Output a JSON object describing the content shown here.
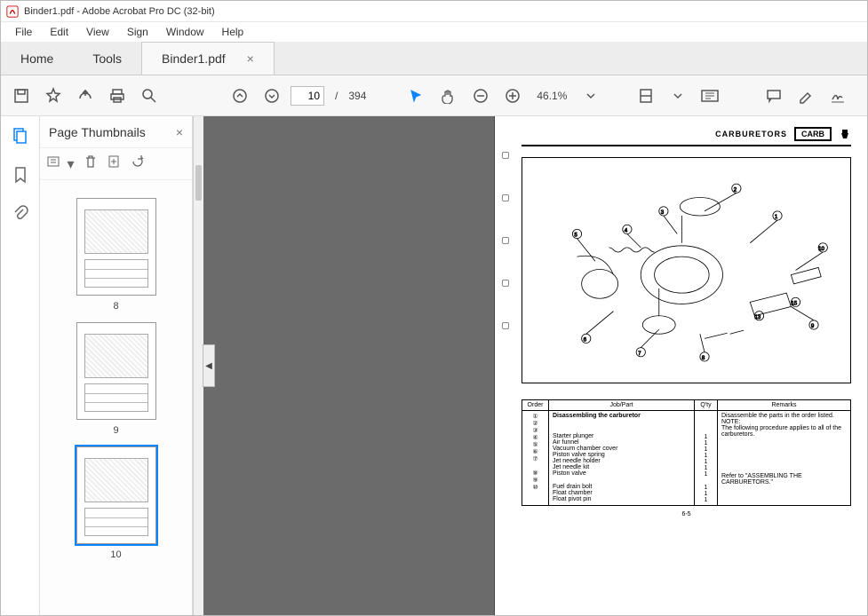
{
  "window": {
    "title": "Binder1.pdf - Adobe Acrobat Pro DC (32-bit)"
  },
  "menu": {
    "file": "File",
    "edit": "Edit",
    "view": "View",
    "sign": "Sign",
    "window": "Window",
    "help": "Help"
  },
  "tabs": {
    "home": "Home",
    "tools": "Tools",
    "doc": "Binder1.pdf"
  },
  "toolbar": {
    "page_current": "10",
    "page_total": "394",
    "zoom": "46.1%",
    "page_sep": "/"
  },
  "thumbs": {
    "title": "Page Thumbnails",
    "items": [
      {
        "num": "8"
      },
      {
        "num": "9"
      },
      {
        "num": "10"
      }
    ]
  },
  "doc": {
    "section": "CARBURETORS",
    "box_label": "CARB",
    "page_num": "6-5",
    "table": {
      "headers": {
        "order": "Order",
        "job": "Job/Part",
        "qty": "Q'ty",
        "remarks": "Remarks"
      },
      "title_row": {
        "job": "Disassembling the carburetor",
        "remarks": "Disassemble the parts in the order listed.\nNOTE:\nThe following procedure applies to all of the carburetors."
      },
      "rows": [
        {
          "order": "①",
          "job": "Starter plunger",
          "qty": "1"
        },
        {
          "order": "②",
          "job": "Air funnel",
          "qty": "1"
        },
        {
          "order": "③",
          "job": "Vacuum chamber cover",
          "qty": "1"
        },
        {
          "order": "④",
          "job": "Piston valve spring",
          "qty": "1"
        },
        {
          "order": "⑤",
          "job": "Jet needle holder",
          "qty": "1"
        },
        {
          "order": "⑥",
          "job": "Jet needle kit",
          "qty": "1"
        },
        {
          "order": "⑦",
          "job": "Piston valve",
          "qty": "1"
        },
        {
          "order": "⑧",
          "job": "Fuel drain bolt",
          "qty": "1"
        },
        {
          "order": "⑨",
          "job": "Float chamber",
          "qty": "1"
        },
        {
          "order": "⑩",
          "job": "Float pivot pin",
          "qty": "1"
        }
      ],
      "remarks_ref": "Refer to \"ASSEMBLING THE CARBURETORS.\""
    }
  }
}
